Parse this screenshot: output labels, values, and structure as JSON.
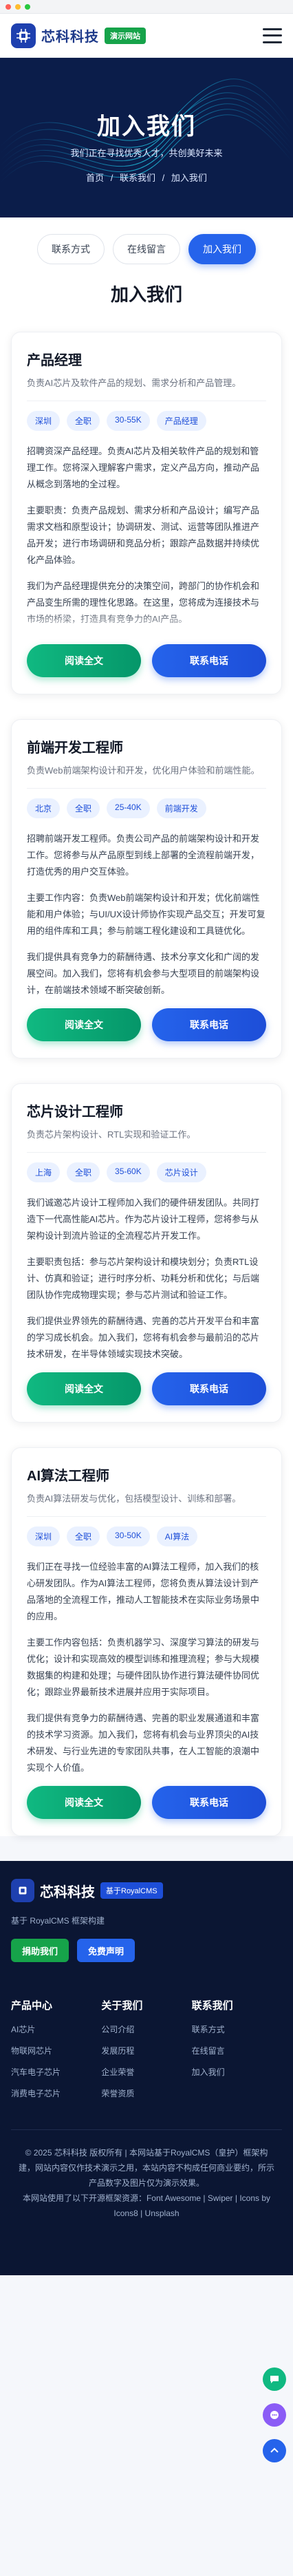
{
  "header": {
    "brand": "芯科科技",
    "demo_badge": "演示网站"
  },
  "hero": {
    "title": "加入我们",
    "subtitle": "我们正在寻找优秀人才，共创美好未来",
    "breadcrumb": [
      "首页",
      "/",
      "联系我们",
      "/",
      "加入我们"
    ]
  },
  "tabs": [
    {
      "label": "联系方式",
      "active": false
    },
    {
      "label": "在线留言",
      "active": false
    },
    {
      "label": "加入我们",
      "active": true
    }
  ],
  "section_title": "加入我们",
  "jobs": [
    {
      "title": "产品经理",
      "desc": "负责AI芯片及软件产品的规划、需求分析和产品管理。",
      "tags": [
        "深圳",
        "全职",
        "30-55K",
        "产品经理"
      ],
      "paras": [
        "招聘资深产品经理。负责AI芯片及相关软件产品的规划和管理工作。您将深入理解客户需求，定义产品方向，推动产品从概念到落地的全过程。",
        "主要职责：负责产品规划、需求分析和产品设计；编写产品需求文档和原型设计；协调研发、测试、运营等团队推进产品开发；进行市场调研和竞品分析；跟踪产品数据并持续优化产品体验。",
        "我们为产品经理提供充分的决策空间，跨部门的协作机会和产品变生所需的理性化思路。在这里，您将成为连接技术与市场的桥梁，打造具有竞争力的AI产品。"
      ],
      "collapsed": true,
      "btn_detail": "阅读全文",
      "btn_contact": "联系电话"
    },
    {
      "title": "前端开发工程师",
      "desc": "负责Web前端架构设计和开发，优化用户体验和前端性能。",
      "tags": [
        "北京",
        "全职",
        "25-40K",
        "前端开发"
      ],
      "paras": [
        "招聘前端开发工程师。负责公司产品的前端架构设计和开发工作。您将参与从产品原型到线上部署的全流程前端开发，打造优秀的用户交互体验。",
        "主要工作内容：负责Web前端架构设计和开发；优化前端性能和用户体验；与UI/UX设计师协作实现产品交互；开发可复用的组件库和工具；参与前端工程化建设和工具链优化。",
        "我们提供具有竞争力的薪酬待遇、技术分享文化和广阔的发展空间。加入我们，您将有机会参与大型项目的前端架构设计，在前端技术领域不断突破创新。"
      ],
      "collapsed": false,
      "btn_detail": "阅读全文",
      "btn_contact": "联系电话"
    },
    {
      "title": "芯片设计工程师",
      "desc": "负责芯片架构设计、RTL实现和验证工作。",
      "tags": [
        "上海",
        "全职",
        "35-60K",
        "芯片设计"
      ],
      "paras": [
        "我们诚邀芯片设计工程师加入我们的硬件研发团队。共同打造下一代高性能AI芯片。作为芯片设计工程师，您将参与从架构设计到流片验证的全流程芯片开发工作。",
        "主要职责包括：参与芯片架构设计和模块划分；负责RTL设计、仿真和验证；进行时序分析、功耗分析和优化；与后端团队协作完成物理实现；参与芯片测试和验证工作。",
        "我们提供业界领先的薪酬待遇、完善的芯片开发平台和丰富的学习成长机会。加入我们，您将有机会参与最前沿的芯片技术研发，在半导体领域实现技术突破。"
      ],
      "collapsed": false,
      "btn_detail": "阅读全文",
      "btn_contact": "联系电话"
    },
    {
      "title": "AI算法工程师",
      "desc": "负责AI算法研发与优化，包括模型设计、训练和部署。",
      "tags": [
        "深圳",
        "全职",
        "30-50K",
        "AI算法"
      ],
      "paras": [
        "我们正在寻找一位经验丰富的AI算法工程师，加入我们的核心研发团队。作为AI算法工程师，您将负责从算法设计到产品落地的全流程工作，推动人工智能技术在实际业务场景中的应用。",
        "主要工作内容包括：负责机器学习、深度学习算法的研发与优化；设计和实现高效的模型训练和推理流程；参与大规模数据集的构建和处理；与硬件团队协作进行算法硬件协同优化；跟踪业界最新技术进展并应用于实际项目。",
        "我们提供有竞争力的薪酬待遇、完善的职业发展通道和丰富的技术学习资源。加入我们，您将有机会与业界顶尖的AI技术研发、与行业先进的专家团队共事，在人工智能的浪潮中实现个人价值。"
      ],
      "collapsed": false,
      "btn_detail": "阅读全文",
      "btn_contact": "联系电话"
    }
  ],
  "footer": {
    "brand": "芯科科技",
    "badge": "基于RoyalCMS",
    "desc": "基于 RoyalCMS 框架构建",
    "btn_donate": "捐助我们",
    "btn_free": "免费声明",
    "columns": [
      {
        "title": "产品中心",
        "items": [
          "AI芯片",
          "物联网芯片",
          "汽车电子芯片",
          "消费电子芯片"
        ]
      },
      {
        "title": "关于我们",
        "items": [
          "公司介绍",
          "发展历程",
          "企业荣誉",
          "荣誉资质"
        ]
      },
      {
        "title": "联系我们",
        "items": [
          "联系方式",
          "在线留言",
          "加入我们"
        ]
      }
    ],
    "copyright": "© 2025 芯科科技 版权所有 | 本网站基于RoyalCMS（皇护）框架构建，网站内容仅作技术演示之用，本站内容不构成任何商业要约，所示产品数字及图片仅为演示效果。",
    "credits": "本网站使用了以下开源框架资源：Font Awesome | Swiper | Icons by Icons8 | Unsplash"
  },
  "floats": [
    "chat-icon",
    "message-icon",
    "scroll-top-icon"
  ],
  "colors": {
    "primary": "#2563eb",
    "green": "#10b981",
    "navy": "#0b1d4a"
  }
}
